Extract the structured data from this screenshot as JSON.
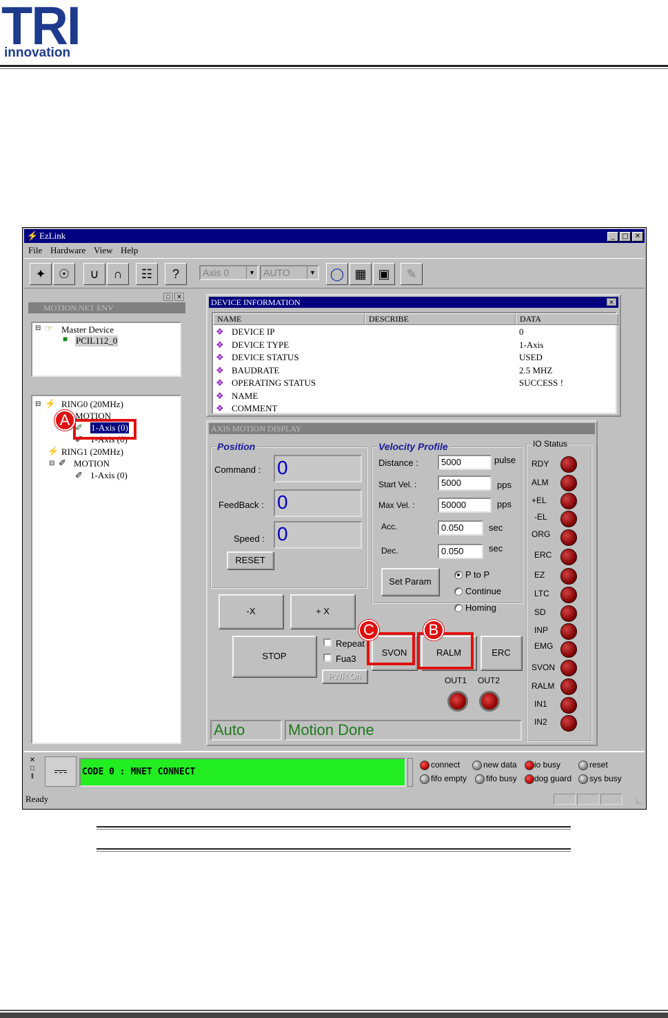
{
  "header": {
    "logo_main": "TRI",
    "logo_sub": "innovation"
  },
  "window": {
    "title": "EzLink",
    "menu": [
      "File",
      "Hardware",
      "View",
      "Help"
    ],
    "toolbar": {
      "axis_select": "Axis 0",
      "mode_select": "AUTO"
    }
  },
  "left_pane": {
    "caption": "MOTION.NET ENV",
    "master_device": "Master Device",
    "card": "PCIL112_0",
    "ring0": "RING0 (20MHz)",
    "motion": "MOTION",
    "axis_selected": "1-Axis (0)",
    "axis_second": "1-Axis (0)",
    "ring1": "RING1 (20MHz)",
    "ring1_motion": "MOTION",
    "ring1_axis": "1-Axis (0)"
  },
  "device_info": {
    "caption": "DEVICE INFORMATION",
    "columns": [
      "NAME",
      "DESCRIBE",
      "DATA"
    ],
    "rows": [
      {
        "name": "DEVICE IP",
        "data": "0"
      },
      {
        "name": "DEVICE TYPE",
        "data": "1-Axis"
      },
      {
        "name": "DEVICE STATUS",
        "data": "USED"
      },
      {
        "name": "BAUDRATE",
        "data": "2.5 MHZ"
      },
      {
        "name": "OPERATING STATUS",
        "data": "SUCCESS !"
      },
      {
        "name": "NAME",
        "data": ""
      },
      {
        "name": "COMMENT",
        "data": ""
      }
    ]
  },
  "axis_display": {
    "caption": "AXIS MOTION DISPLAY",
    "position": {
      "title": "Position",
      "command_label": "Command :",
      "command_value": "0",
      "feedback_label": "FeedBack :",
      "feedback_value": "0",
      "speed_label": "Speed :",
      "speed_value": "0",
      "reset_label": "RESET"
    },
    "velocity": {
      "title": "Velocity Profile",
      "distance_label": "Distance :",
      "distance_value": "5000",
      "distance_unit": "pulse",
      "start_label": "Start Vel. :",
      "start_value": "5000",
      "start_unit": "pps",
      "max_label": "Max Vel. :",
      "max_value": "50000",
      "max_unit": "pps",
      "acc_label": "Acc.",
      "acc_value": "0.050",
      "acc_unit": "sec",
      "dec_label": "Dec.",
      "dec_value": "0.050",
      "dec_unit": "sec",
      "set_param_label": "Set Param",
      "mode_p2p": "P to P",
      "mode_continue": "Continue",
      "mode_homing": "Homing"
    },
    "controls": {
      "minus_x": "-X",
      "plus_x": "+ X",
      "stop": "STOP",
      "repeat": "Repeat",
      "fua3": "Fua3",
      "pwr_on": "PWR On",
      "svon": "SVON",
      "ralm": "RALM",
      "erc": "ERC",
      "out1": "OUT1",
      "out2": "OUT2"
    },
    "io_status": {
      "title": "IO Status",
      "signals": [
        "RDY",
        "ALM",
        "+EL",
        "-EL",
        "ORG",
        "ERC",
        "EZ",
        "LTC",
        "SD",
        "INP",
        "EMG",
        "SVON",
        "RALM",
        "IN1",
        "IN2"
      ]
    },
    "mode_text": "Auto",
    "state_text": "Motion Done"
  },
  "annotations": {
    "a": "A",
    "b": "B",
    "c": "C",
    "highlight_color": "#e01010"
  },
  "bottom": {
    "code_text": "CODE 0 : MNET CONNECT",
    "code_color": "#22ee22",
    "status_leds": [
      {
        "label": "connect",
        "color": "red"
      },
      {
        "label": "new data",
        "color": "grey"
      },
      {
        "label": "io busy",
        "color": "red"
      },
      {
        "label": "reset",
        "color": "grey"
      },
      {
        "label": "fifo empty",
        "color": "grey"
      },
      {
        "label": "fifo busy",
        "color": "grey"
      },
      {
        "label": "dog guard",
        "color": "red"
      },
      {
        "label": "sys busy",
        "color": "grey"
      }
    ],
    "status_text": "Ready"
  }
}
